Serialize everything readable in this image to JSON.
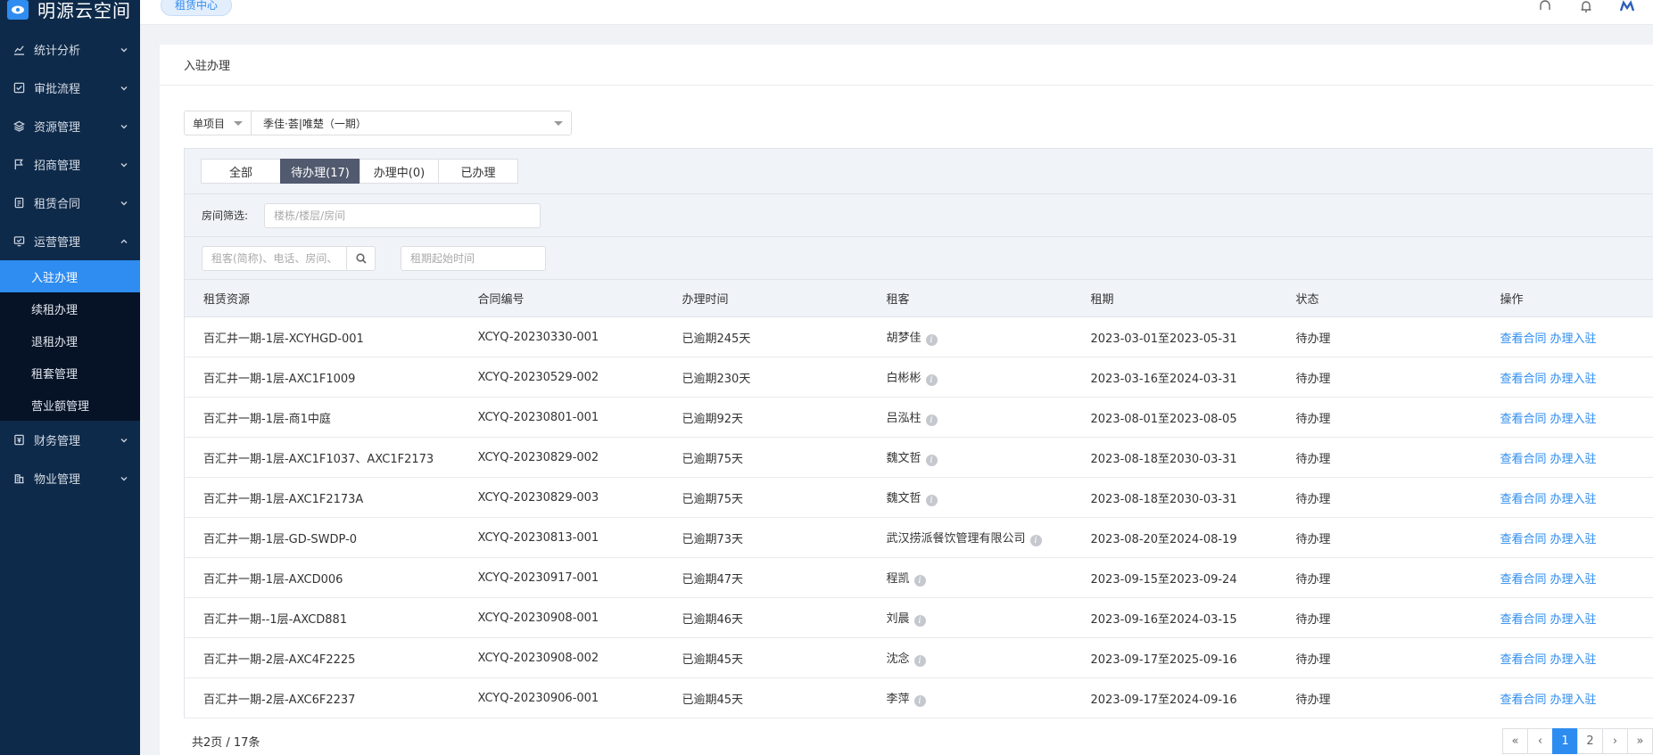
{
  "app": {
    "title": "明源云空间"
  },
  "sidebar": {
    "menus": [
      {
        "label": "统计分析",
        "icon": "chart-icon",
        "expanded": false
      },
      {
        "label": "审批流程",
        "icon": "check-square-icon",
        "expanded": false
      },
      {
        "label": "资源管理",
        "icon": "layers-icon",
        "expanded": false
      },
      {
        "label": "招商管理",
        "icon": "flag-icon",
        "expanded": false
      },
      {
        "label": "租赁合同",
        "icon": "document-icon",
        "expanded": false
      },
      {
        "label": "运营管理",
        "icon": "monitor-icon",
        "expanded": true
      },
      {
        "label": "财务管理",
        "icon": "money-icon",
        "expanded": false
      },
      {
        "label": "物业管理",
        "icon": "building-icon",
        "expanded": false
      }
    ],
    "submenu": [
      "入驻办理",
      "续租办理",
      "退租办理",
      "租套管理",
      "营业额管理"
    ],
    "active_submenu": "入驻办理"
  },
  "topbar": {
    "tag": "租赁中心"
  },
  "card": {
    "title": "入驻办理"
  },
  "filters": {
    "mode": "单项目",
    "project": "季佳·荟|唯楚（一期）"
  },
  "tabs": [
    {
      "label": "全部",
      "active": false
    },
    {
      "label": "待办理(17)",
      "active": true
    },
    {
      "label": "办理中(0)",
      "active": false
    },
    {
      "label": "已办理",
      "active": false
    }
  ],
  "room_filter": {
    "label": "房间筛选:",
    "placeholder": "楼栋/楼层/房间"
  },
  "search": {
    "placeholder": "租客(简称)、电话、房间、",
    "date_placeholder": "租期起始时间"
  },
  "table": {
    "columns": [
      "租赁资源",
      "合同编号",
      "办理时间",
      "租客",
      "租期",
      "状态",
      "操作"
    ],
    "actions": [
      "查看合同",
      "办理入驻"
    ],
    "rows": [
      {
        "resource": "百汇井一期-1层-XCYHGD-001",
        "contract": "XCYQ-20230330-001",
        "time": "已逾期245天",
        "tenant": "胡梦佳",
        "period": "2023-03-01至2023-05-31",
        "status": "待办理"
      },
      {
        "resource": "百汇井一期-1层-AXC1F1009",
        "contract": "XCYQ-20230529-002",
        "time": "已逾期230天",
        "tenant": "白彬彬",
        "period": "2023-03-16至2024-03-31",
        "status": "待办理"
      },
      {
        "resource": "百汇井一期-1层-商1中庭",
        "contract": "XCYQ-20230801-001",
        "time": "已逾期92天",
        "tenant": "吕泓柱",
        "period": "2023-08-01至2023-08-05",
        "status": "待办理"
      },
      {
        "resource": "百汇井一期-1层-AXC1F1037、AXC1F2173",
        "contract": "XCYQ-20230829-002",
        "time": "已逾期75天",
        "tenant": "魏文哲",
        "period": "2023-08-18至2030-03-31",
        "status": "待办理"
      },
      {
        "resource": "百汇井一期-1层-AXC1F2173A",
        "contract": "XCYQ-20230829-003",
        "time": "已逾期75天",
        "tenant": "魏文哲",
        "period": "2023-08-18至2030-03-31",
        "status": "待办理"
      },
      {
        "resource": "百汇井一期-1层-GD-SWDP-0",
        "contract": "XCYQ-20230813-001",
        "time": "已逾期73天",
        "tenant": "武汉捞派餐饮管理有限公司",
        "period": "2023-08-20至2024-08-19",
        "status": "待办理"
      },
      {
        "resource": "百汇井一期-1层-AXCD006",
        "contract": "XCYQ-20230917-001",
        "time": "已逾期47天",
        "tenant": "程凯",
        "period": "2023-09-15至2023-09-24",
        "status": "待办理"
      },
      {
        "resource": "百汇井一期--1层-AXCD881",
        "contract": "XCYQ-20230908-001",
        "time": "已逾期46天",
        "tenant": "刘晨",
        "period": "2023-09-16至2024-03-15",
        "status": "待办理"
      },
      {
        "resource": "百汇井一期-2层-AXC4F2225",
        "contract": "XCYQ-20230908-002",
        "time": "已逾期45天",
        "tenant": "沈念",
        "period": "2023-09-17至2025-09-16",
        "status": "待办理"
      },
      {
        "resource": "百汇井一期-2层-AXC6F2237",
        "contract": "XCYQ-20230906-001",
        "time": "已逾期45天",
        "tenant": "李萍",
        "period": "2023-09-17至2024-09-16",
        "status": "待办理"
      }
    ]
  },
  "pagination": {
    "summary": "共2页 / 17条",
    "pages": [
      "«",
      "‹",
      "1",
      "2",
      "›",
      "»"
    ],
    "current": "1"
  },
  "colors": {
    "sidebar_bg": "#0e2a4a",
    "accent": "#2f8cf0",
    "active_tab": "#515a6e"
  }
}
